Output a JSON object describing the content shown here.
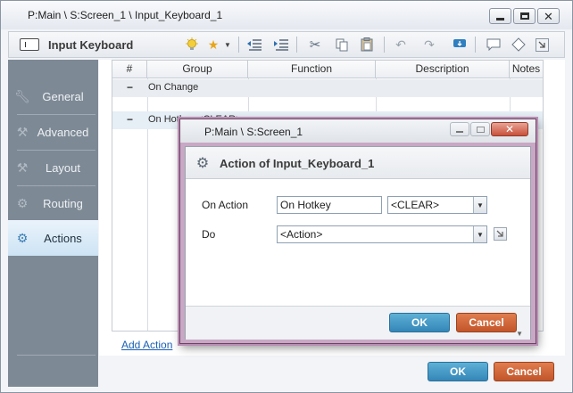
{
  "window": {
    "title": "P:Main \\ S:Screen_1 \\ Input_Keyboard_1"
  },
  "toolbar": {
    "title": "Input Keyboard",
    "icons": [
      "form-icon",
      "lightbulb-icon",
      "star-icon",
      "outdent-icon",
      "indent-icon",
      "cut-icon",
      "copy-icon",
      "paste-icon",
      "undo-icon",
      "redo-icon",
      "download-icon",
      "comment-icon",
      "tag-icon",
      "jump-icon"
    ]
  },
  "sidebar": {
    "items": [
      {
        "label": "General",
        "icon": "wrench-icon"
      },
      {
        "label": "Advanced",
        "icon": "tools-icon"
      },
      {
        "label": "Layout",
        "icon": "layout-icon"
      },
      {
        "label": "Routing",
        "icon": "routing-icon"
      },
      {
        "label": "Actions",
        "icon": "actions-icon",
        "active": true
      }
    ]
  },
  "grid": {
    "columns": [
      "#",
      "Group",
      "Function",
      "Description",
      "Notes"
    ],
    "groups": [
      {
        "toggle": "−",
        "label": "On Change"
      },
      {
        "toggle": "−",
        "label": "On Hotkey <CLEAR>"
      }
    ],
    "add_action": "Add Action"
  },
  "footer": {
    "ok": "OK",
    "cancel": "Cancel"
  },
  "dialog": {
    "title": "P:Main \\ S:Screen_1",
    "header": "Action of Input_Keyboard_1",
    "on_action_label": "On Action",
    "on_action_value": "On Hotkey",
    "hotkey_value": "<CLEAR>",
    "do_label": "Do",
    "do_value": "<Action>",
    "ok": "OK",
    "cancel": "Cancel"
  },
  "colors": {
    "accent_blue": "#3486b8",
    "cancel_orange": "#c2552a",
    "sidebar_bg": "#7d8995",
    "dialog_border": "#b98fb4"
  }
}
